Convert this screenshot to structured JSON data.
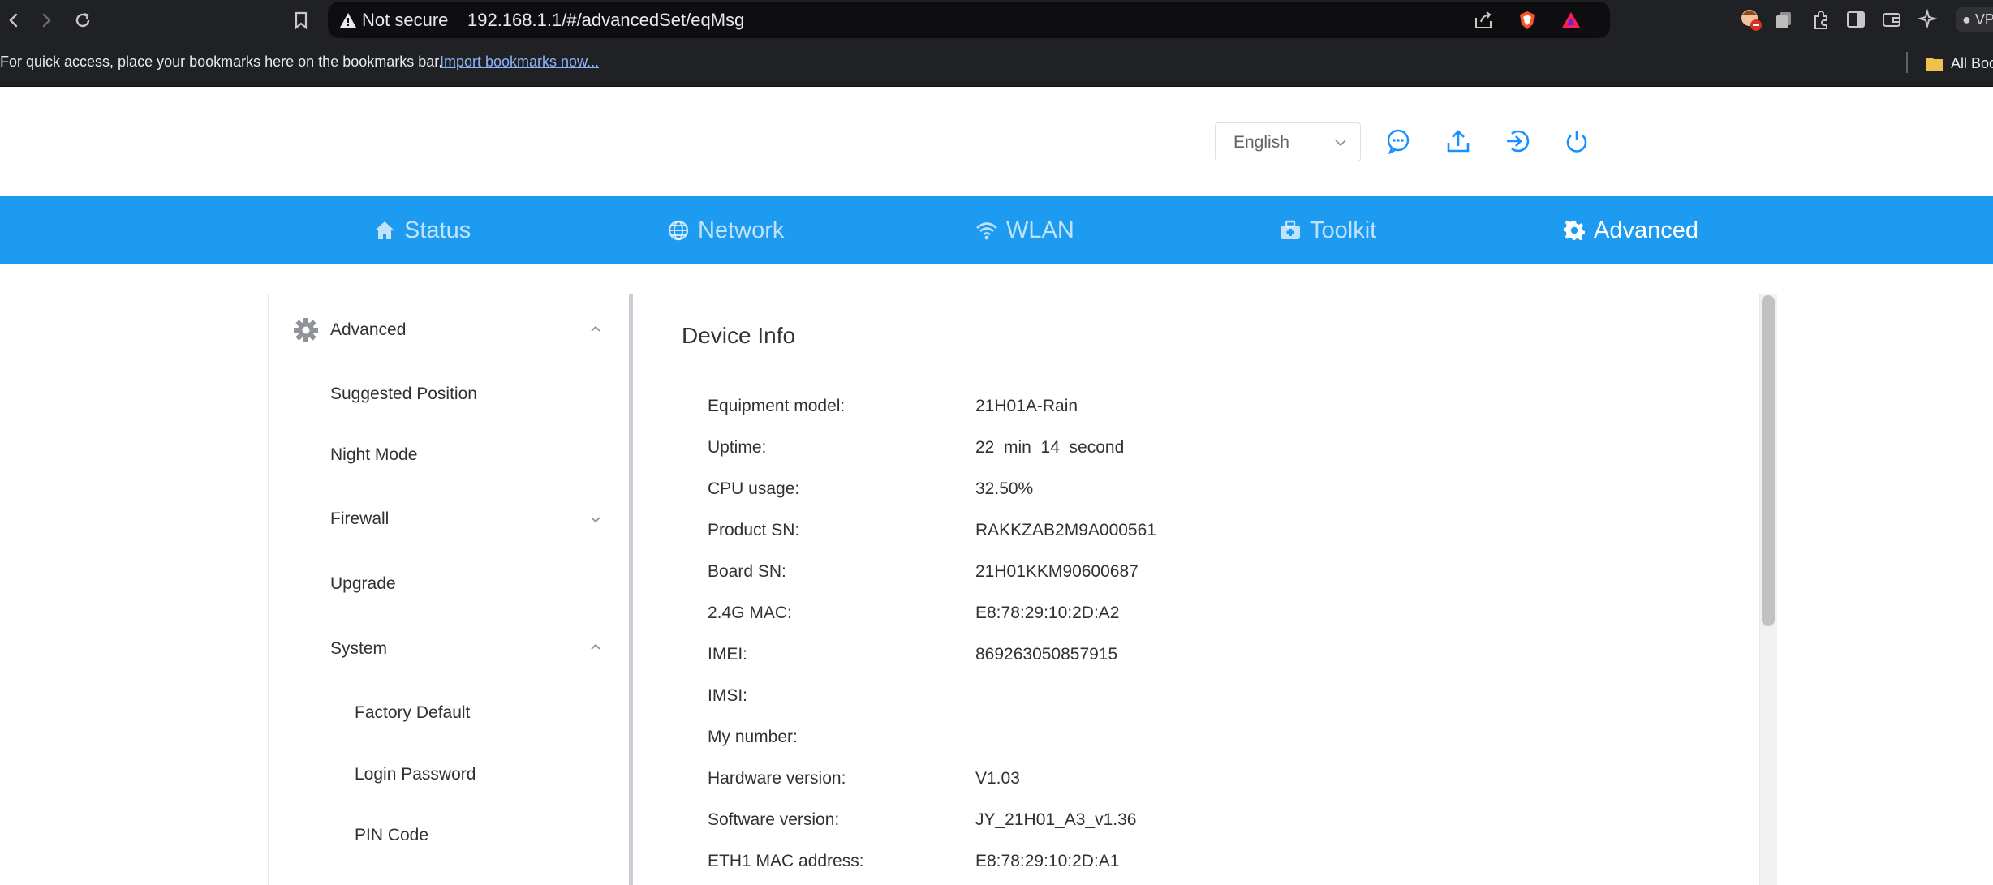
{
  "browser": {
    "security_label": "Not secure",
    "url": "192.168.1.1/#/advancedSet/eqMsg",
    "vpn_label": "VP",
    "icons": [
      "back-icon",
      "forward-icon",
      "reload-icon",
      "bookmark-icon",
      "warning-icon",
      "share-icon",
      "brave-shield-icon",
      "brave-rewards-icon",
      "extension-icon",
      "sidebar-icon",
      "wallet-icon",
      "leo-icon"
    ]
  },
  "bookmarks_bar": {
    "message": "For quick access, place your bookmarks here on the bookmarks bar.",
    "import_link": "Import bookmarks now...",
    "all_bookmarks": "All Boo"
  },
  "header": {
    "language": "English"
  },
  "nav": {
    "tabs": [
      {
        "label": "Status",
        "icon": "home-icon"
      },
      {
        "label": "Network",
        "icon": "globe-icon"
      },
      {
        "label": "WLAN",
        "icon": "wifi-icon"
      },
      {
        "label": "Toolkit",
        "icon": "toolkit-icon"
      },
      {
        "label": "Advanced",
        "icon": "gear-icon"
      }
    ],
    "active": "Advanced"
  },
  "sidebar": {
    "group_label": "Advanced",
    "items": [
      {
        "label": "Suggested Position"
      },
      {
        "label": "Night Mode"
      },
      {
        "label": "Firewall"
      },
      {
        "label": "Upgrade"
      },
      {
        "label": "System"
      }
    ],
    "system_items": [
      {
        "label": "Factory Default"
      },
      {
        "label": "Login Password"
      },
      {
        "label": "PIN Code"
      }
    ]
  },
  "content": {
    "title": "Device Info",
    "rows": [
      {
        "label": "Equipment model:",
        "value": "21H01A-Rain"
      },
      {
        "label": "Uptime:",
        "value": "22  min  14  second"
      },
      {
        "label": "CPU usage:",
        "value": "32.50%"
      },
      {
        "label": "Product SN:",
        "value": "RAKKZAB2M9A000561"
      },
      {
        "label": "Board SN:",
        "value": "21H01KKM90600687"
      },
      {
        "label": "2.4G MAC:",
        "value": "E8:78:29:10:2D:A2"
      },
      {
        "label": "IMEI:",
        "value": "869263050857915"
      },
      {
        "label": "IMSI:",
        "value": ""
      },
      {
        "label": "My number:",
        "value": ""
      },
      {
        "label": "Hardware version:",
        "value": "V1.03"
      },
      {
        "label": "Software version:",
        "value": "JY_21H01_A3_v1.36"
      },
      {
        "label": "ETH1 MAC address:",
        "value": "E8:78:29:10:2D:A1"
      }
    ]
  },
  "colors": {
    "nav_blue": "#1d9bf0",
    "icon_blue": "#1890ff",
    "chrome_dark": "#202124"
  }
}
